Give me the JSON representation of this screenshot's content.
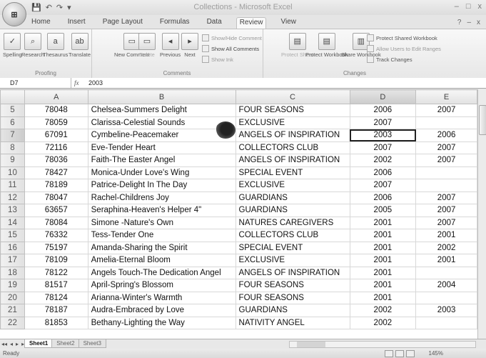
{
  "window": {
    "title": "Collections - Microsoft Excel",
    "controls": [
      "–",
      "□",
      "x"
    ]
  },
  "office_button": {
    "label": "⊞"
  },
  "qat": [
    "💾",
    "↶",
    "↷",
    "▾"
  ],
  "tabs": [
    "Home",
    "Insert",
    "Page Layout",
    "Formulas",
    "Data",
    "Review",
    "View"
  ],
  "active_tab": "Review",
  "ribbon_right": [
    "?",
    "–",
    "x"
  ],
  "ribbon": {
    "proofing": {
      "label": "Proofing",
      "buttons": [
        "Spelling",
        "Research",
        "Thesaurus",
        "Translate"
      ]
    },
    "comments": {
      "label": "Comments",
      "buttons": [
        "New Comment",
        "Delete",
        "Previous",
        "Next"
      ],
      "small": [
        "Show/Hide Comment",
        "Show All Comments",
        "Show Ink"
      ]
    },
    "changes": {
      "label": "Changes",
      "buttons": [
        "Protect Sheet",
        "Protect Workbook",
        "Share Workbook"
      ],
      "small": [
        "Protect Shared Workbook",
        "Allow Users to Edit Ranges",
        "Track Changes"
      ]
    }
  },
  "formula_bar": {
    "cell": "D7",
    "fx": "fx",
    "value": "2003"
  },
  "columns": [
    "A",
    "B",
    "C",
    "D",
    "E"
  ],
  "active_column": "D",
  "active_row": 7,
  "rows": [
    {
      "n": "5",
      "a": "78048",
      "b": "Chelsea-Summers Delight",
      "c": "FOUR SEASONS",
      "d": "2006",
      "e": "2007"
    },
    {
      "n": "6",
      "a": "78059",
      "b": "Clarissa-Celestial Sounds",
      "c": "EXCLUSIVE",
      "d": "2007",
      "e": ""
    },
    {
      "n": "7",
      "a": "67091",
      "b": "Cymbeline-Peacemaker",
      "c": "ANGELS OF INSPIRATION",
      "d": "2003",
      "e": "2006"
    },
    {
      "n": "8",
      "a": "72116",
      "b": "Eve-Tender Heart",
      "c": "COLLECTORS CLUB",
      "d": "2007",
      "e": "2007"
    },
    {
      "n": "9",
      "a": "78036",
      "b": "Faith-The Easter Angel",
      "c": "ANGELS OF INSPIRATION",
      "d": "2002",
      "e": "2007"
    },
    {
      "n": "10",
      "a": "78427",
      "b": "Monica-Under Love's Wing",
      "c": "SPECIAL EVENT",
      "d": "2006",
      "e": ""
    },
    {
      "n": "11",
      "a": "78189",
      "b": "Patrice-Delight In The Day",
      "c": "EXCLUSIVE",
      "d": "2007",
      "e": ""
    },
    {
      "n": "12",
      "a": "78047",
      "b": "Rachel-Childrens Joy",
      "c": "GUARDIANS",
      "d": "2006",
      "e": "2007"
    },
    {
      "n": "13",
      "a": "63657",
      "b": "Seraphina-Heaven's Helper 4\"",
      "c": "GUARDIANS",
      "d": "2005",
      "e": "2007"
    },
    {
      "n": "14",
      "a": "78084",
      "b": "Simone -Nature's Own",
      "c": "NATURES CAREGIVERS",
      "d": "2001",
      "e": "2007"
    },
    {
      "n": "15",
      "a": "76332",
      "b": "Tess-Tender One",
      "c": "COLLECTORS CLUB",
      "d": "2001",
      "e": "2001"
    },
    {
      "n": "16",
      "a": "75197",
      "b": "Amanda-Sharing the Spirit",
      "c": "SPECIAL EVENT",
      "d": "2001",
      "e": "2002"
    },
    {
      "n": "17",
      "a": "78109",
      "b": "Amelia-Eternal Bloom",
      "c": "EXCLUSIVE",
      "d": "2001",
      "e": "2001"
    },
    {
      "n": "18",
      "a": "78122",
      "b": "Angels Touch-The Dedication Angel",
      "c": "ANGELS OF INSPIRATION",
      "d": "2001",
      "e": ""
    },
    {
      "n": "19",
      "a": "81517",
      "b": "April-Spring's Blossom",
      "c": "FOUR SEASONS",
      "d": "2001",
      "e": "2004"
    },
    {
      "n": "20",
      "a": "78124",
      "b": "Arianna-Winter's Warmth",
      "c": "FOUR SEASONS",
      "d": "2001",
      "e": ""
    },
    {
      "n": "21",
      "a": "78187",
      "b": "Audra-Embraced by Love",
      "c": "GUARDIANS",
      "d": "2002",
      "e": "2003"
    },
    {
      "n": "22",
      "a": "81853",
      "b": "Bethany-Lighting the Way",
      "c": "NATIVITY ANGEL",
      "d": "2002",
      "e": ""
    }
  ],
  "sheet_nav": [
    "◂◂",
    "◂",
    "▸",
    "▸▸"
  ],
  "sheets": [
    "Sheet1",
    "Sheet2",
    "Sheet3"
  ],
  "active_sheet": "Sheet1",
  "status": {
    "text": "Ready",
    "zoom": "145%"
  }
}
